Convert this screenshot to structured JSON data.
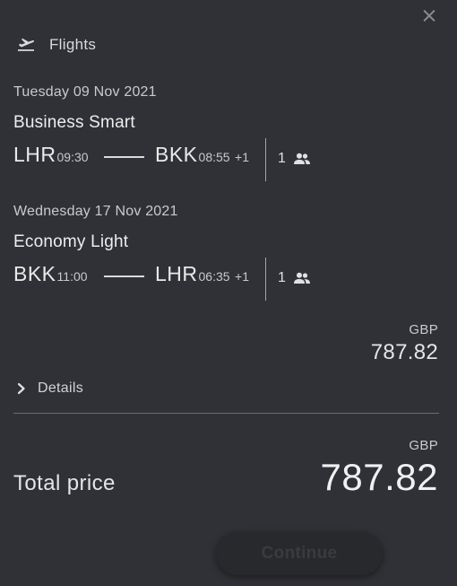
{
  "header": {
    "title": "Flights",
    "icon": "plane-takeoff-icon",
    "close_icon": "close-icon"
  },
  "legs": [
    {
      "date": "Tuesday 09 Nov 2021",
      "fare": "Business Smart",
      "origin": "LHR",
      "departure_time": "09:30",
      "destination": "BKK",
      "arrival_time": "08:55",
      "day_offset": "+1",
      "passengers": "1"
    },
    {
      "date": "Wednesday 17 Nov 2021",
      "fare": "Economy Light",
      "origin": "BKK",
      "departure_time": "11:00",
      "destination": "LHR",
      "arrival_time": "06:35",
      "day_offset": "+1",
      "passengers": "1"
    }
  ],
  "subtotal": {
    "currency": "GBP",
    "amount": "787.82"
  },
  "details": {
    "label": "Details"
  },
  "total": {
    "label": "Total price",
    "currency": "GBP",
    "amount": "787.82"
  },
  "actions": {
    "continue_label": "Continue"
  },
  "colors": {
    "background": "#303136",
    "text": "#e9e9ea",
    "muted": "#c9cacd"
  }
}
